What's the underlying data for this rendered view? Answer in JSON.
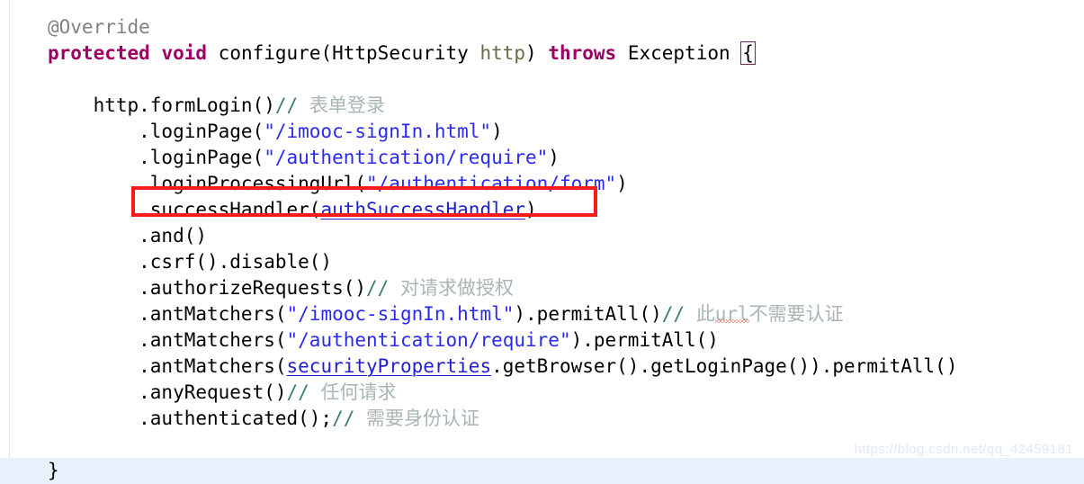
{
  "editor": {
    "language": "java",
    "background_color": "#ffffff",
    "current_line_color": "#e8f2fd",
    "colors": {
      "keyword": "#9c0064",
      "string": "#2a2aee",
      "field_reference": "#2222cc",
      "comment_slashes": "#3d7a70",
      "comment_text": "#a8b6b4",
      "annotation": "#808080",
      "parameter": "#6a6a4a",
      "highlight_box": "#ff1a1a",
      "brace_match_outline": "#7a2464"
    }
  },
  "code": {
    "lines": [
      {
        "id": "line-override",
        "tokens": [
          {
            "type": "annotation",
            "text": "@Override"
          }
        ]
      },
      {
        "id": "line-method-signature",
        "tokens": [
          {
            "type": "keyword",
            "text": "protected"
          },
          {
            "type": "plain",
            "text": " "
          },
          {
            "type": "keyword",
            "text": "void"
          },
          {
            "type": "plain",
            "text": " configure(HttpSecurity "
          },
          {
            "type": "param",
            "text": "http"
          },
          {
            "type": "plain",
            "text": ") "
          },
          {
            "type": "keyword",
            "text": "throws"
          },
          {
            "type": "plain",
            "text": " Exception "
          },
          {
            "type": "brace",
            "text": "{"
          }
        ]
      },
      {
        "id": "line-blank-1",
        "tokens": []
      },
      {
        "id": "line-formlogin",
        "tokens": [
          {
            "type": "plain",
            "text": "    http.formLogin()"
          },
          {
            "type": "slashes",
            "text": "//"
          },
          {
            "type": "comment",
            "text": " 表单登录"
          }
        ]
      },
      {
        "id": "line-loginpage-signin",
        "tokens": [
          {
            "type": "plain",
            "text": "        .loginPage("
          },
          {
            "type": "string",
            "text": "\"/imooc-signIn.html\""
          },
          {
            "type": "plain",
            "text": ")"
          }
        ]
      },
      {
        "id": "line-loginpage-require",
        "tokens": [
          {
            "type": "plain",
            "text": "        .loginPage("
          },
          {
            "type": "string",
            "text": "\"/authentication/require\""
          },
          {
            "type": "plain",
            "text": ")"
          }
        ]
      },
      {
        "id": "line-loginprocessingurl",
        "tokens": [
          {
            "type": "plain",
            "text": "        .loginProcessingUrl("
          },
          {
            "type": "string",
            "text": "\"/authentication/form\""
          },
          {
            "type": "plain",
            "text": ")"
          }
        ]
      },
      {
        "id": "line-successhandler",
        "highlighted": true,
        "tokens": [
          {
            "type": "plain",
            "text": "        .successHandler("
          },
          {
            "type": "field",
            "text": "authSuccessHandler"
          },
          {
            "type": "plain",
            "text": ")"
          }
        ]
      },
      {
        "id": "line-and",
        "tokens": [
          {
            "type": "plain",
            "text": "        .and()"
          }
        ]
      },
      {
        "id": "line-csrf-disable",
        "tokens": [
          {
            "type": "plain",
            "text": "        .csrf().disable()"
          }
        ]
      },
      {
        "id": "line-authorizerequests",
        "tokens": [
          {
            "type": "plain",
            "text": "        .authorizeRequests()"
          },
          {
            "type": "slashes",
            "text": "//"
          },
          {
            "type": "comment",
            "text": " 对请求做授权"
          }
        ]
      },
      {
        "id": "line-antmatchers-signin",
        "tokens": [
          {
            "type": "plain",
            "text": "        .antMatchers("
          },
          {
            "type": "string",
            "text": "\"/imooc-signIn.html\""
          },
          {
            "type": "plain",
            "text": ").permitAll()"
          },
          {
            "type": "slashes",
            "text": "//"
          },
          {
            "type": "comment",
            "text": " 此"
          },
          {
            "type": "comment-misspelled",
            "text": "url"
          },
          {
            "type": "comment",
            "text": "不需要认证"
          }
        ]
      },
      {
        "id": "line-antmatchers-require",
        "tokens": [
          {
            "type": "plain",
            "text": "        .antMatchers("
          },
          {
            "type": "string",
            "text": "\"/authentication/require\""
          },
          {
            "type": "plain",
            "text": ").permitAll()"
          }
        ]
      },
      {
        "id": "line-antmatchers-securityproperties",
        "tokens": [
          {
            "type": "plain",
            "text": "        .antMatchers("
          },
          {
            "type": "field",
            "text": "securityProperties"
          },
          {
            "type": "plain",
            "text": ".getBrowser().getLoginPage()).permitAll()"
          }
        ]
      },
      {
        "id": "line-anyrequest",
        "tokens": [
          {
            "type": "plain",
            "text": "        .anyRequest()"
          },
          {
            "type": "slashes",
            "text": "//"
          },
          {
            "type": "comment",
            "text": " 任何请求"
          }
        ]
      },
      {
        "id": "line-authenticated",
        "tokens": [
          {
            "type": "plain",
            "text": "        .authenticated();"
          },
          {
            "type": "slashes",
            "text": "//"
          },
          {
            "type": "comment",
            "text": " 需要身份认证"
          }
        ]
      },
      {
        "id": "line-blank-2",
        "tokens": []
      },
      {
        "id": "line-closing-brace",
        "current": true,
        "tokens": [
          {
            "type": "plain",
            "text": "}"
          }
        ]
      }
    ]
  },
  "annotations": {
    "highlight_box": {
      "label": "red-rectangle-around-successHandler-line",
      "target_line": "line-successhandler"
    }
  },
  "watermark": {
    "text": "https://blog.csdn.net/qq_42459181"
  }
}
